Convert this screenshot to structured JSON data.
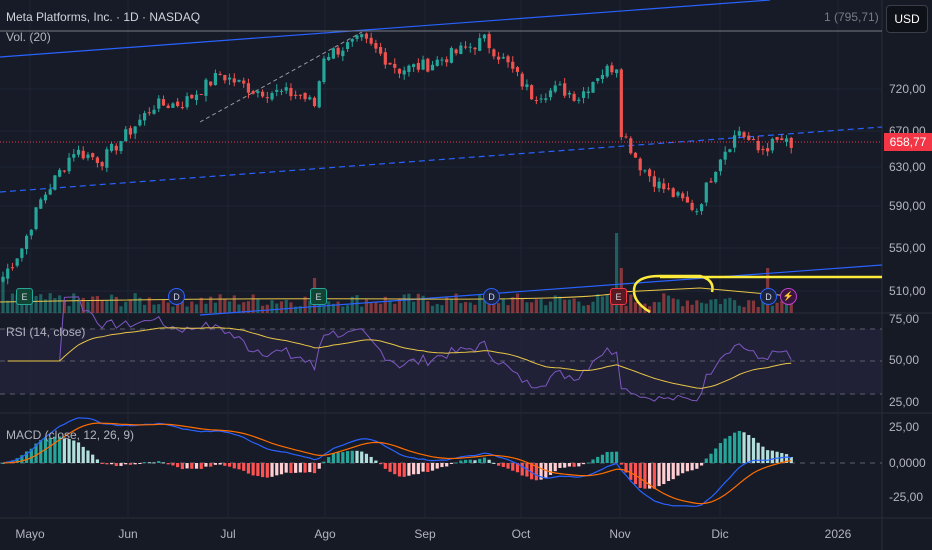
{
  "header": {
    "title": "Meta Platforms, Inc. · 1D · NASDAQ",
    "volume_label": "Vol. (20)",
    "top_marker": "1 (795,71)",
    "currency": "USD"
  },
  "price": {
    "last": "658,77",
    "axis": [
      "720,00",
      "670,00",
      "630,00",
      "590,00",
      "550,00",
      "510,00"
    ]
  },
  "rsi": {
    "label": "RSI (14, close)",
    "axis": [
      "75,00",
      "50,00",
      "25,00"
    ]
  },
  "macd": {
    "label": "MACD (close, 12, 26, 9)",
    "axis": [
      "25,00",
      "0,0000",
      "-25,00"
    ]
  },
  "time_axis": [
    "Mayo",
    "Jun",
    "Jul",
    "Ago",
    "Sep",
    "Oct",
    "Nov",
    "Dic",
    "2026"
  ],
  "events": [
    {
      "type": "earnings",
      "glyph": "E"
    },
    {
      "type": "dividend",
      "glyph": "D"
    },
    {
      "type": "earnings",
      "glyph": "E"
    },
    {
      "type": "dividend",
      "glyph": "D"
    },
    {
      "type": "earnings",
      "glyph": "E"
    },
    {
      "type": "dividend",
      "glyph": "D"
    },
    {
      "type": "split",
      "glyph": "⚡"
    }
  ],
  "colors": {
    "up": "#26a69a",
    "down": "#ef5350",
    "rsi": "#7e57c2",
    "rsi_ma": "#e8c547",
    "macd": "#2962ff",
    "signal": "#ff6d00",
    "highlight": "#ffeb3b"
  },
  "chart_data": {
    "type": "candlestick",
    "title": "Meta Platforms, Inc. · 1D · NASDAQ",
    "ylim": [
      490,
      800
    ],
    "price_path": [
      [
        0,
        525
      ],
      [
        4,
        555
      ],
      [
        8,
        604
      ],
      [
        15,
        656
      ],
      [
        21,
        646
      ],
      [
        27,
        677
      ],
      [
        32,
        703
      ],
      [
        38,
        705
      ],
      [
        46,
        735
      ],
      [
        53,
        719
      ],
      [
        63,
        714
      ],
      [
        66,
        703
      ],
      [
        68,
        755
      ],
      [
        76,
        771
      ],
      [
        79,
        760
      ],
      [
        84,
        740
      ],
      [
        90,
        745
      ],
      [
        97,
        760
      ],
      [
        102,
        771
      ],
      [
        107,
        745
      ],
      [
        112,
        714
      ],
      [
        118,
        720
      ],
      [
        122,
        712
      ],
      [
        126,
        735
      ],
      [
        130,
        745
      ],
      [
        131,
        677
      ],
      [
        135,
        641
      ],
      [
        139,
        620
      ],
      [
        145,
        600
      ],
      [
        147,
        595
      ],
      [
        152,
        651
      ],
      [
        156,
        677
      ],
      [
        160,
        656
      ],
      [
        165,
        667
      ],
      [
        167,
        658.77
      ]
    ]
  }
}
